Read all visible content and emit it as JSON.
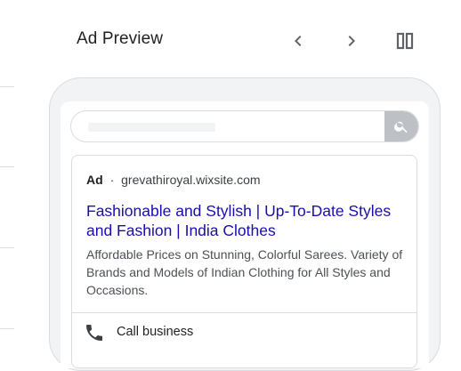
{
  "header": {
    "title": "Ad Preview",
    "prev_icon": "chevron-left-icon",
    "next_icon": "chevron-right-icon",
    "layout_icon": "split-view-icon"
  },
  "search": {
    "icon": "search-icon"
  },
  "ad": {
    "label": "Ad",
    "separator": "·",
    "domain": "grevathiroyal.wixsite.com",
    "headline": "Fashionable and Stylish | Up-To-Date Styles and Fashion | India Clothes",
    "description": "Affordable Prices on Stunning, Colorful Sarees. Variety of Brands and Models of Indian Clothing for All Styles and Occasions.",
    "call_label": "Call business",
    "call_icon": "phone-icon"
  },
  "colors": {
    "headline": "#1a0dab",
    "search_button": "#bdc1c6",
    "device_frame": "#f1f3f4"
  }
}
